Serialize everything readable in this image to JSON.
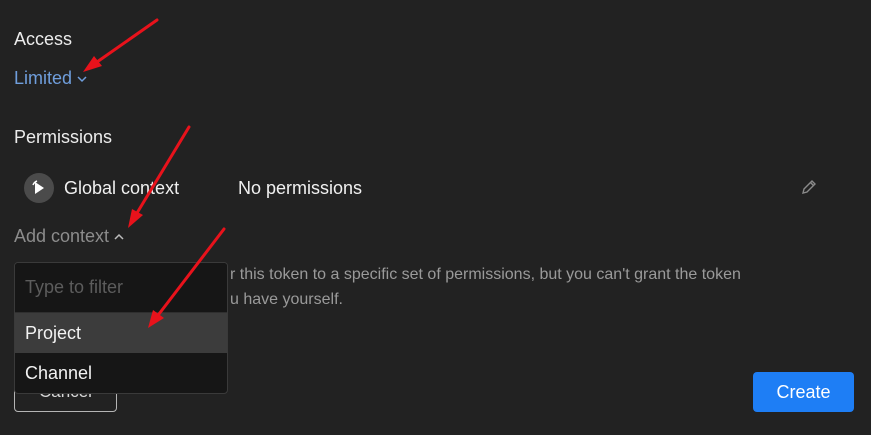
{
  "access": {
    "label": "Access",
    "value": "Limited"
  },
  "permissions": {
    "label": "Permissions",
    "rows": [
      {
        "context": "Global context",
        "permission": "No permissions"
      }
    ]
  },
  "add_context": {
    "label": "Add context",
    "filter_placeholder": "Type to filter",
    "options": [
      "Project",
      "Channel"
    ],
    "highlighted": "Project"
  },
  "help_text": "r this token to a specific set of permissions, but you can't grant the token u have yourself.",
  "help_lines": [
    "r this token to a specific set of permissions, but you can't grant the token",
    "u have yourself."
  ],
  "footer": {
    "cancel_label": "Cancel",
    "create_label": "Create"
  },
  "colors": {
    "background": "#222222",
    "accent_link": "#6f9edc",
    "primary_button": "#1e7ef5",
    "annotation_arrow": "#e8121b"
  },
  "icons": {
    "access_dropdown": "chevron-down-icon",
    "add_context_toggle": "chevron-up-icon",
    "context_avatar": "play-logo-icon",
    "edit": "pencil-icon"
  }
}
